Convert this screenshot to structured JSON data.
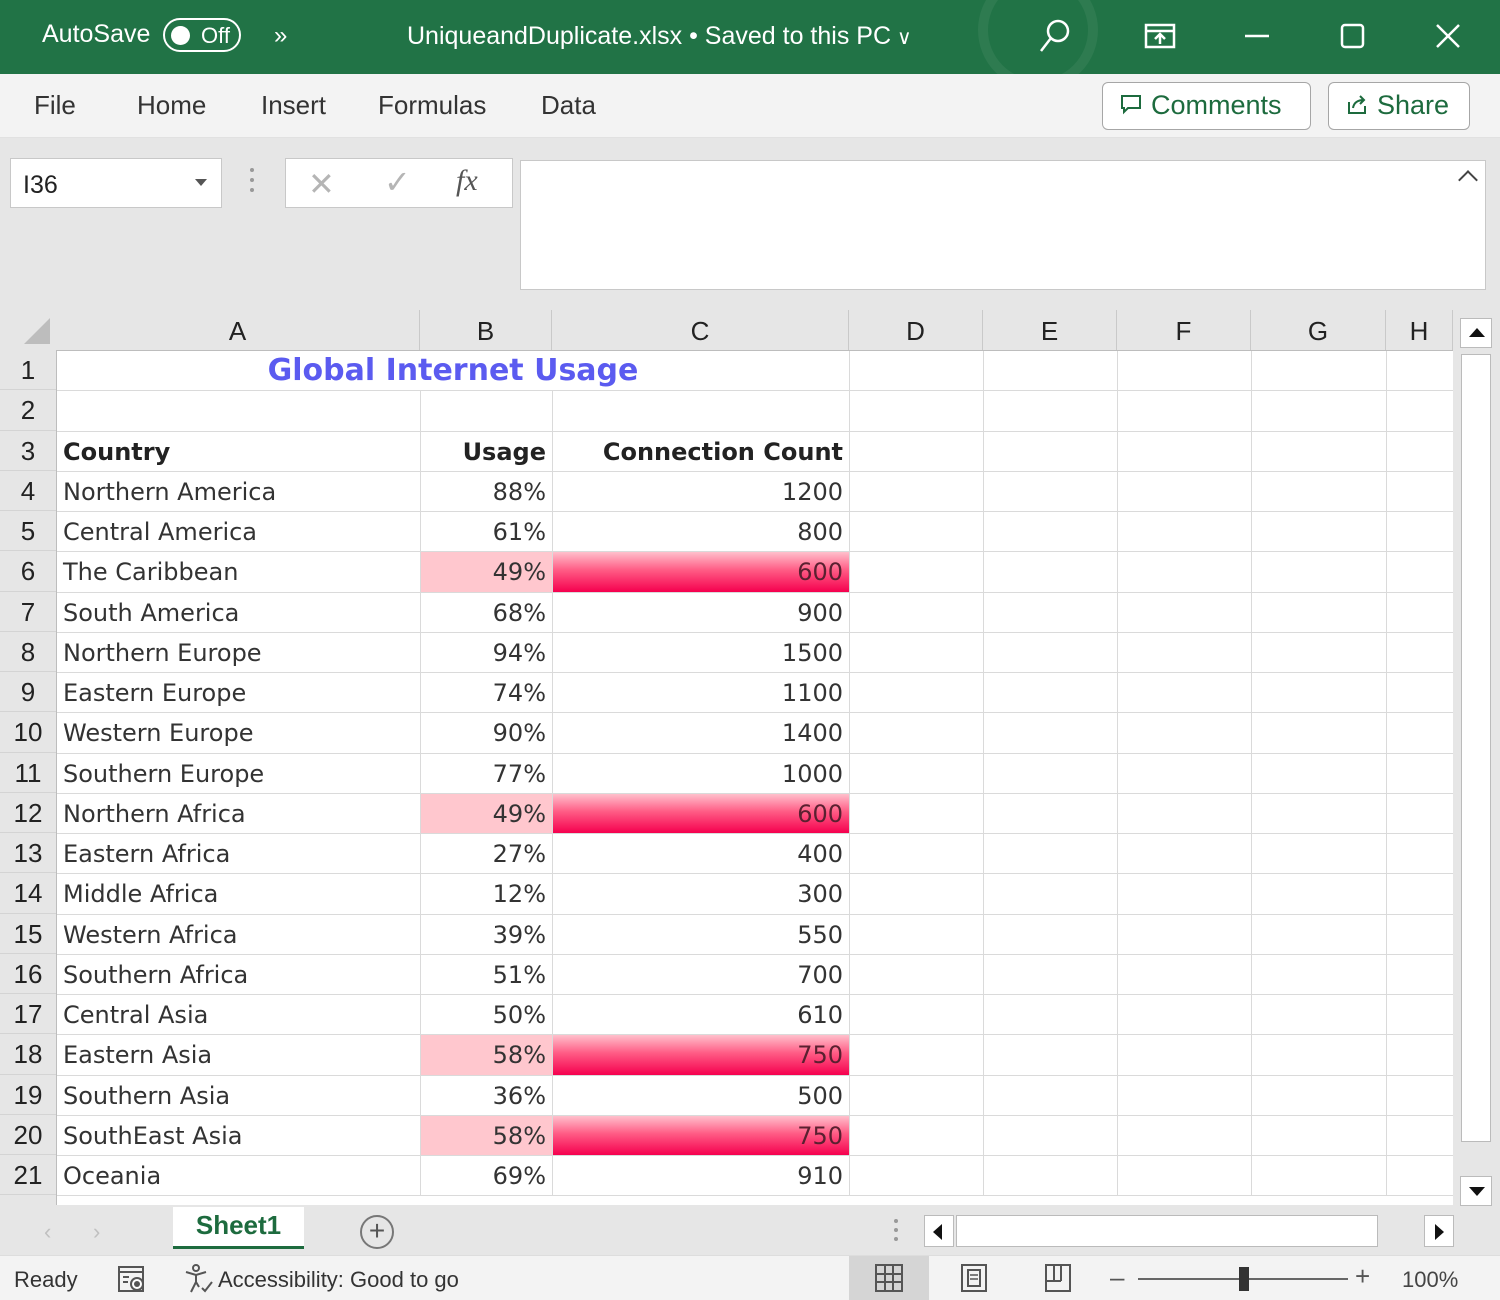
{
  "titlebar": {
    "autosave_label": "AutoSave",
    "autosave_state": "Off",
    "more_label": "»",
    "document_title": "UniqueandDuplicate.xlsx • Saved to this PC",
    "title_chevron": "∨",
    "accent_color": "#217346"
  },
  "ribbon": {
    "tabs": [
      "File",
      "Home",
      "Insert",
      "Formulas",
      "Data"
    ],
    "comments_label": "Comments",
    "share_label": "Share"
  },
  "formula_bar": {
    "name_box": "I36",
    "cancel_glyph": "✕",
    "enter_glyph": "✓",
    "fx_label": "fx",
    "formula_value": ""
  },
  "columns": [
    "A",
    "B",
    "C",
    "D",
    "E",
    "F",
    "G",
    "H"
  ],
  "rows": [
    "1",
    "2",
    "3",
    "4",
    "5",
    "6",
    "7",
    "8",
    "9",
    "10",
    "11",
    "12",
    "13",
    "14",
    "15",
    "16",
    "17",
    "18",
    "19",
    "20",
    "21"
  ],
  "sheet": {
    "title": "Global Internet Usage",
    "title_color": "#5b5bf0",
    "headers": [
      "Country",
      "Usage",
      "Connection Count"
    ],
    "duplicate_highlight_light": "#ffc7ce",
    "duplicate_highlight_strong": "#f5004e",
    "data": [
      {
        "country": "Northern America",
        "usage": "88%",
        "count": "1200",
        "duplicate": false
      },
      {
        "country": "Central America",
        "usage": "61%",
        "count": "800",
        "duplicate": false
      },
      {
        "country": "The Caribbean",
        "usage": "49%",
        "count": "600",
        "duplicate": true
      },
      {
        "country": "South America",
        "usage": "68%",
        "count": "900",
        "duplicate": false
      },
      {
        "country": "Northern Europe",
        "usage": "94%",
        "count": "1500",
        "duplicate": false
      },
      {
        "country": "Eastern Europe",
        "usage": "74%",
        "count": "1100",
        "duplicate": false
      },
      {
        "country": "Western Europe",
        "usage": "90%",
        "count": "1400",
        "duplicate": false
      },
      {
        "country": "Southern Europe",
        "usage": "77%",
        "count": "1000",
        "duplicate": false
      },
      {
        "country": "Northern Africa",
        "usage": "49%",
        "count": "600",
        "duplicate": true
      },
      {
        "country": "Eastern Africa",
        "usage": "27%",
        "count": "400",
        "duplicate": false
      },
      {
        "country": "Middle Africa",
        "usage": "12%",
        "count": "300",
        "duplicate": false
      },
      {
        "country": "Western Africa",
        "usage": "39%",
        "count": "550",
        "duplicate": false
      },
      {
        "country": "Southern Africa",
        "usage": "51%",
        "count": "700",
        "duplicate": false
      },
      {
        "country": "Central Asia",
        "usage": "50%",
        "count": "610",
        "duplicate": false
      },
      {
        "country": "Eastern Asia",
        "usage": "58%",
        "count": "750",
        "duplicate": true
      },
      {
        "country": "Southern Asia",
        "usage": "36%",
        "count": "500",
        "duplicate": false
      },
      {
        "country": "SouthEast Asia",
        "usage": "58%",
        "count": "750",
        "duplicate": true
      },
      {
        "country": "Oceania",
        "usage": "69%",
        "count": "910",
        "duplicate": false
      }
    ]
  },
  "sheet_tabs": {
    "active": "Sheet1",
    "add_glyph": "+"
  },
  "statusbar": {
    "ready": "Ready",
    "accessibility": "Accessibility: Good to go",
    "zoom_level": "100%",
    "zoom_minus": "–",
    "zoom_plus": "+"
  }
}
